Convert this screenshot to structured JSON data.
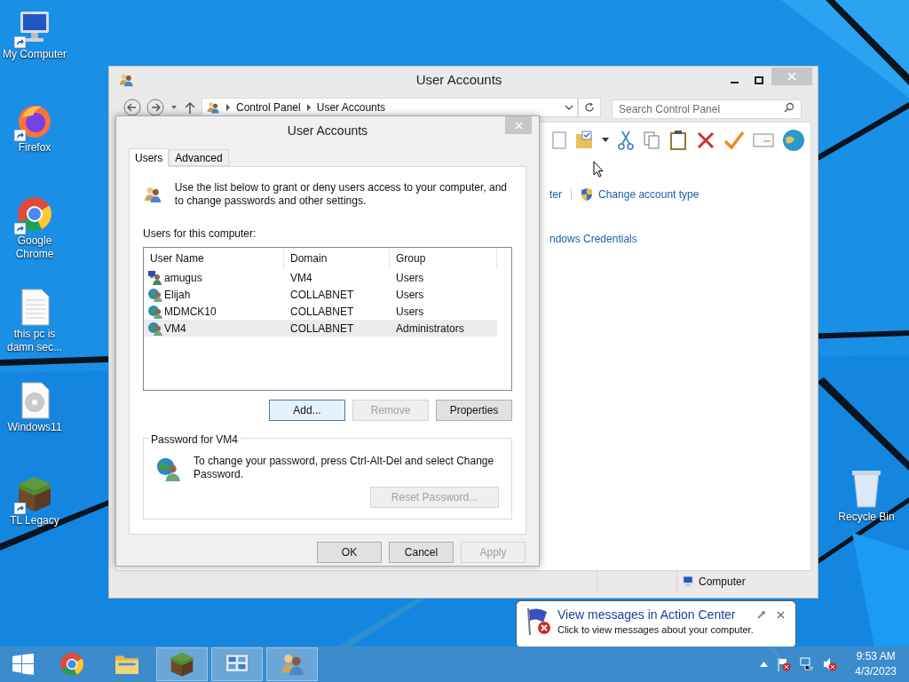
{
  "desktop_icons": [
    {
      "label": "My Computer",
      "kind": "computer",
      "shortcut": true
    },
    {
      "label": "Firefox",
      "kind": "firefox",
      "shortcut": true
    },
    {
      "label": "Google Chrome",
      "kind": "chrome",
      "shortcut": true
    },
    {
      "label": "this pc is damn sec...",
      "kind": "text",
      "shortcut": false
    },
    {
      "label": "Windows11",
      "kind": "disc",
      "shortcut": false
    },
    {
      "label": "TL Legacy",
      "kind": "block",
      "shortcut": true
    }
  ],
  "recycle_bin": {
    "label": "Recycle Bin"
  },
  "explorer_window": {
    "title": "User Accounts",
    "breadcrumb": [
      "Control Panel",
      "User Accounts"
    ],
    "search": {
      "placeholder": "Search Control Panel"
    },
    "links": [
      {
        "text": "ter",
        "kind": "plain"
      },
      {
        "text": "Change account type",
        "kind": "shield"
      },
      {
        "text": "ndows Credentials",
        "kind": "plain"
      }
    ],
    "status_bar": {
      "text": "Computer"
    }
  },
  "dialog": {
    "title": "User Accounts",
    "tabs": [
      {
        "label": "Users",
        "selected": true
      },
      {
        "label": "Advanced",
        "selected": false
      }
    ],
    "intro": "Use the list below to grant or deny users access to your computer, and to change passwords and other settings.",
    "list_label": "Users for this computer:",
    "table": {
      "columns": [
        "User Name",
        "Domain",
        "Group"
      ],
      "rows": [
        {
          "cells": [
            "amugus",
            "VM4",
            "Users"
          ],
          "kind": "local",
          "selected": false
        },
        {
          "cells": [
            "Elijah",
            "COLLABNET",
            "Users"
          ],
          "kind": "domain",
          "selected": false
        },
        {
          "cells": [
            "MDMCK10",
            "COLLABNET",
            "Users"
          ],
          "kind": "domain",
          "selected": false
        },
        {
          "cells": [
            "VM4",
            "COLLABNET",
            "Administrators"
          ],
          "kind": "domain",
          "selected": true
        }
      ]
    },
    "buttons": [
      {
        "label": "Add...",
        "disabled": false,
        "focused": true
      },
      {
        "label": "Remove",
        "disabled": true,
        "focused": false
      },
      {
        "label": "Properties",
        "disabled": false,
        "focused": false
      }
    ],
    "password_group": {
      "title": "Password for VM4",
      "text": "To change your password, press Ctrl-Alt-Del and select Change Password.",
      "button": {
        "label": "Reset Password...",
        "disabled": true
      }
    },
    "footer_buttons": [
      {
        "label": "OK",
        "disabled": false
      },
      {
        "label": "Cancel",
        "disabled": false
      },
      {
        "label": "Apply",
        "disabled": true
      }
    ]
  },
  "notification": {
    "title": "View messages in Action Center",
    "message": "Click to view messages about your computer."
  },
  "taskbar": {
    "apps": [
      {
        "kind": "chrome",
        "active": false
      },
      {
        "kind": "folder",
        "active": false
      },
      {
        "kind": "block",
        "active": true
      },
      {
        "kind": "panel",
        "active": true
      },
      {
        "kind": "users",
        "active": true
      }
    ],
    "time": "9:53 AM",
    "date": "4/3/2023"
  }
}
